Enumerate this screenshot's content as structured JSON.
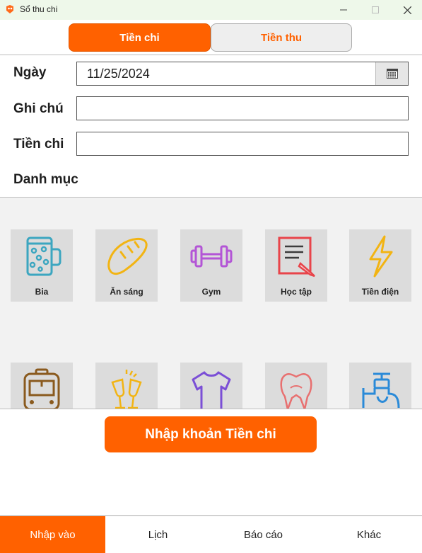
{
  "window": {
    "title": "Sổ thu chi",
    "accent_color": "#ff6100"
  },
  "tabs": [
    {
      "label": "Tiền chi",
      "active": true
    },
    {
      "label": "Tiền thu",
      "active": false
    }
  ],
  "form": {
    "date_label": "Ngày",
    "date_value": "11/25/2024",
    "note_label": "Ghi chú",
    "note_value": "",
    "amount_label": "Tiền chi",
    "amount_value": "",
    "category_label": "Danh mục"
  },
  "categories": [
    {
      "label": "Bia",
      "icon": "beer-mug-icon"
    },
    {
      "label": "Ăn sáng",
      "icon": "bread-icon"
    },
    {
      "label": "Gym",
      "icon": "dumbbell-icon"
    },
    {
      "label": "Học tập",
      "icon": "study-notebook-icon"
    },
    {
      "label": "Tiền điện",
      "icon": "lightning-icon"
    },
    {
      "label": "",
      "icon": "bus-icon"
    },
    {
      "label": "",
      "icon": "cheers-glasses-icon"
    },
    {
      "label": "",
      "icon": "tshirt-icon"
    },
    {
      "label": "",
      "icon": "tooth-icon"
    },
    {
      "label": "",
      "icon": "water-tap-icon"
    }
  ],
  "submit_label": "Nhập khoản Tiền chi",
  "bottom_nav": [
    {
      "label": "Nhập vào",
      "active": true
    },
    {
      "label": "Lịch",
      "active": false
    },
    {
      "label": "Báo cáo",
      "active": false
    },
    {
      "label": "Khác",
      "active": false
    }
  ]
}
